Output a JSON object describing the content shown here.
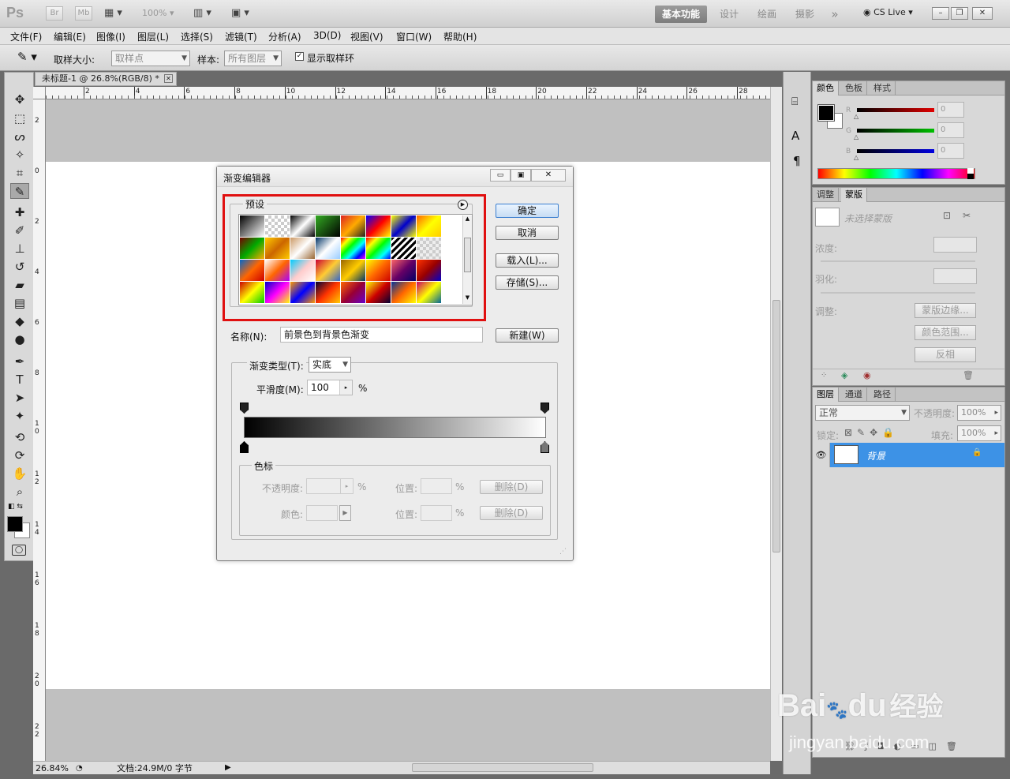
{
  "app": {
    "logo": "Ps",
    "bridge_label": "Br",
    "minibridge_label": "Mb",
    "zoom_combo": "100%",
    "workspaces": [
      "基本功能",
      "设计",
      "绘画",
      "摄影"
    ],
    "more_label": "»",
    "cslive": "CS Live",
    "window_buttons": [
      "–",
      "❐",
      "✕"
    ]
  },
  "menu": [
    "文件(F)",
    "编辑(E)",
    "图像(I)",
    "图层(L)",
    "选择(S)",
    "滤镜(T)",
    "分析(A)",
    "3D(D)",
    "视图(V)",
    "窗口(W)",
    "帮助(H)"
  ],
  "options": {
    "sample_size_label": "取样大小:",
    "sample_size_value": "取样点",
    "sample_label": "样本:",
    "sample_value": "所有图层",
    "show_ring_label": "显示取样环"
  },
  "document": {
    "tab_title": "未标题-1 @ 26.8%(RGB/8) *",
    "ruler_top": [
      "2",
      "4",
      "6",
      "8",
      "10",
      "12",
      "14",
      "16",
      "18",
      "20",
      "22",
      "24",
      "26",
      "28"
    ],
    "ruler_left": [
      "2",
      "0",
      "2",
      "4",
      "6",
      "8",
      "1\n0",
      "1\n2",
      "1\n4",
      "1\n6",
      "1\n8",
      "2\n0",
      "2\n2"
    ],
    "zoom": "26.84%",
    "doc_info": "文档:24.9M/0 字节"
  },
  "color_panel": {
    "tabs": [
      "颜色",
      "色板",
      "样式"
    ],
    "channels": [
      {
        "name": "R",
        "value": "0",
        "color": "#e00000"
      },
      {
        "name": "G",
        "value": "0",
        "color": "#00c000"
      },
      {
        "name": "B",
        "value": "0",
        "color": "#0000e0"
      }
    ]
  },
  "masks_panel": {
    "tabs": [
      "调整",
      "蒙版"
    ],
    "no_mask": "未选择蒙版",
    "density_label": "浓度:",
    "feather_label": "羽化:",
    "refine_label": "调整:",
    "mask_edge_button": "蒙版边缘...",
    "color_range_button": "颜色范围...",
    "invert_button": "反相"
  },
  "layers_panel": {
    "tabs": [
      "图层",
      "通道",
      "路径"
    ],
    "blend_mode": "正常",
    "opacity_label": "不透明度:",
    "opacity_value": "100%",
    "lock_label": "锁定:",
    "fill_label": "填充:",
    "fill_value": "100%",
    "layer_name": "背景"
  },
  "dialog": {
    "title": "渐变编辑器",
    "presets_label": "预设",
    "ok_button": "确定",
    "cancel_button": "取消",
    "load_button": "载入(L)...",
    "save_button": "存储(S)...",
    "name_label": "名称(N):",
    "name_value": "前景色到背景色渐变",
    "new_button": "新建(W)",
    "gradient_type_label": "渐变类型(T):",
    "gradient_type_value": "实底",
    "smoothness_label": "平滑度(M):",
    "smoothness_value": "100",
    "percent": "%",
    "stops_label": "色标",
    "opacity_label": "不透明度:",
    "location_label": "位置:",
    "color_label": "颜色:",
    "delete_button": "删除(D)",
    "highlight_color": "#e01010"
  },
  "watermark": {
    "brand": "Bai",
    "brand_end": "du",
    "brand_cn": "经验",
    "url": "jingyan.baidu.com"
  }
}
